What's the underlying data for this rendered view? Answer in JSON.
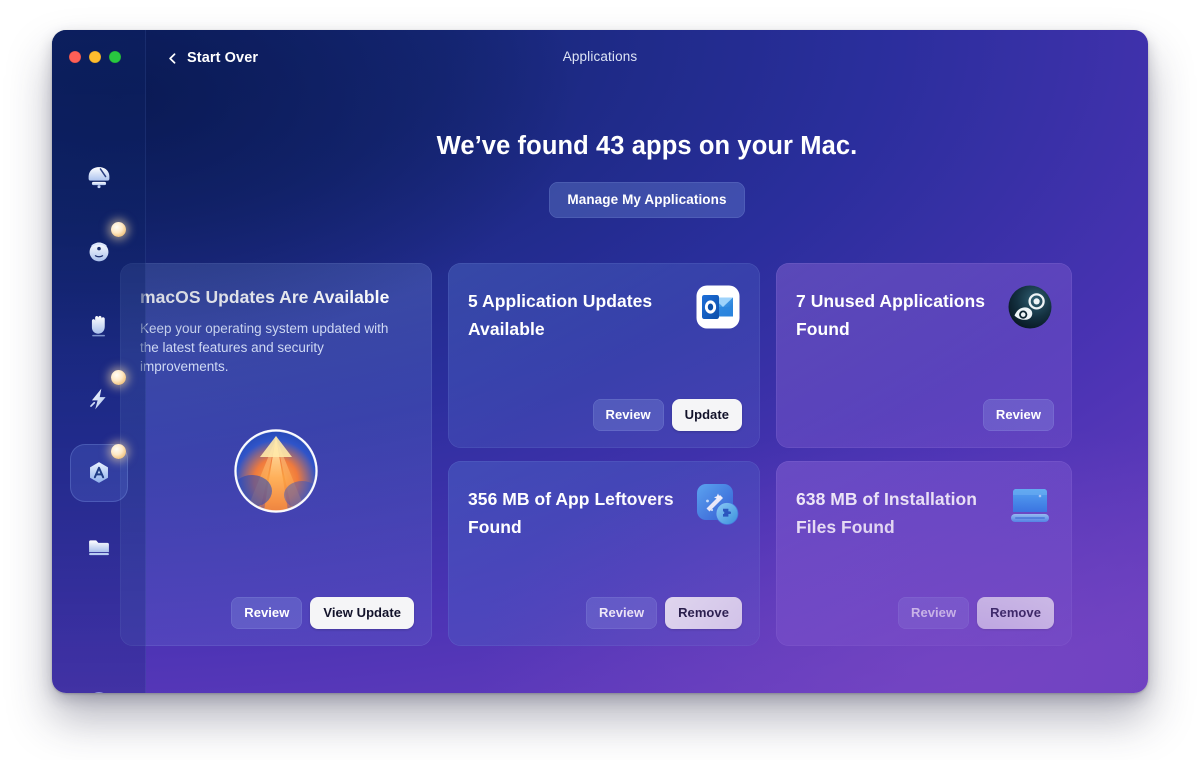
{
  "window": {
    "title": "Applications",
    "back_label": "Start Over",
    "traffic_lights": [
      "close",
      "minimize",
      "zoom"
    ]
  },
  "main": {
    "headline": "We’ve found 43 apps on your Mac.",
    "app_count": 43,
    "manage_button": "Manage My Applications"
  },
  "sidebar": {
    "items": [
      {
        "name": "smart-scan",
        "icon": "scan-broom-icon",
        "badge": false,
        "selected": false
      },
      {
        "name": "protection",
        "icon": "shield-scan-icon",
        "badge": true,
        "selected": false
      },
      {
        "name": "cleanup",
        "icon": "hand-icon",
        "badge": false,
        "selected": false
      },
      {
        "name": "performance",
        "icon": "lightning-icon",
        "badge": true,
        "selected": false
      },
      {
        "name": "applications",
        "icon": "applications-hex-icon",
        "badge": true,
        "selected": true
      },
      {
        "name": "my-clutter",
        "icon": "folder-icon",
        "badge": false,
        "selected": false
      },
      {
        "name": "assistant",
        "icon": "assistant-orb-icon",
        "badge": false,
        "selected": false
      }
    ]
  },
  "cards": [
    {
      "id": "macos-updates",
      "title": "macOS Updates Are Available",
      "description": "Keep your operating system updated with the latest features and security improvements.",
      "icon": "macos-update-icon",
      "buttons": [
        {
          "label": "Review",
          "style": "ghost"
        },
        {
          "label": "View Update",
          "style": "solid"
        }
      ]
    },
    {
      "id": "application-updates",
      "title": "5 Application Updates Available",
      "count": 5,
      "icon": "outlook-app-icon",
      "buttons": [
        {
          "label": "Review",
          "style": "ghost"
        },
        {
          "label": "Update",
          "style": "solid"
        }
      ]
    },
    {
      "id": "unused-applications",
      "title": "7 Unused Applications Found",
      "count": 7,
      "icon": "steam-app-icon",
      "buttons": [
        {
          "label": "Review",
          "style": "ghost"
        }
      ]
    },
    {
      "id": "app-leftovers",
      "title": "356 MB of App Leftovers Found",
      "size": "356 MB",
      "icon": "app-leftovers-icon",
      "buttons": [
        {
          "label": "Review",
          "style": "ghost"
        },
        {
          "label": "Remove",
          "style": "solid"
        }
      ]
    },
    {
      "id": "installation-files",
      "title": "638 MB of Installation Files Found",
      "size": "638 MB",
      "icon": "disk-image-icon",
      "buttons": [
        {
          "label": "Review",
          "style": "ghost"
        },
        {
          "label": "Remove",
          "style": "solid"
        }
      ]
    }
  ],
  "colors": {
    "window_gradient_start": "#10246e",
    "window_gradient_end": "#6a3fbf",
    "accent_badge": "#ffe9c6",
    "solid_button_bg": "#f5f5f7",
    "solid_button_text": "#12122a",
    "traffic_close": "#ff5f57",
    "traffic_min": "#febc2e",
    "traffic_zoom": "#28c840"
  }
}
